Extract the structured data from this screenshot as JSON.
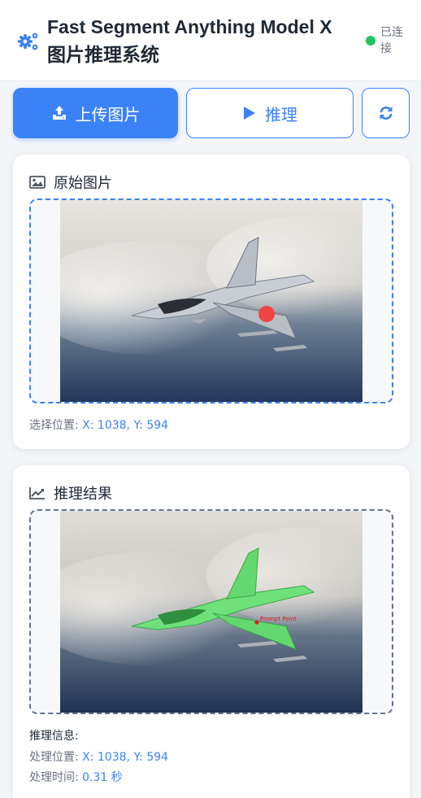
{
  "header": {
    "title_line1": "Fast Segment Anything Model X",
    "title_line2": "图片推理系统",
    "status_line1": "已连",
    "status_line2": "接",
    "status_color": "#22c55e",
    "icon": "gear-icon"
  },
  "toolbar": {
    "upload_label": "上传图片",
    "infer_label": "推理",
    "refresh_icon": "refresh-icon",
    "accent": "#3b82f6"
  },
  "original": {
    "title": "原始图片",
    "position_label": "选择位置:",
    "position_value": "X: 1038, Y: 594"
  },
  "result": {
    "title": "推理结果",
    "prompt_label": "Prompt Point",
    "info_title": "推理信息:",
    "position_label": "处理位置:",
    "position_value": "X: 1038, Y: 594",
    "time_label": "处理时间:",
    "time_value": "0.31 秒"
  }
}
